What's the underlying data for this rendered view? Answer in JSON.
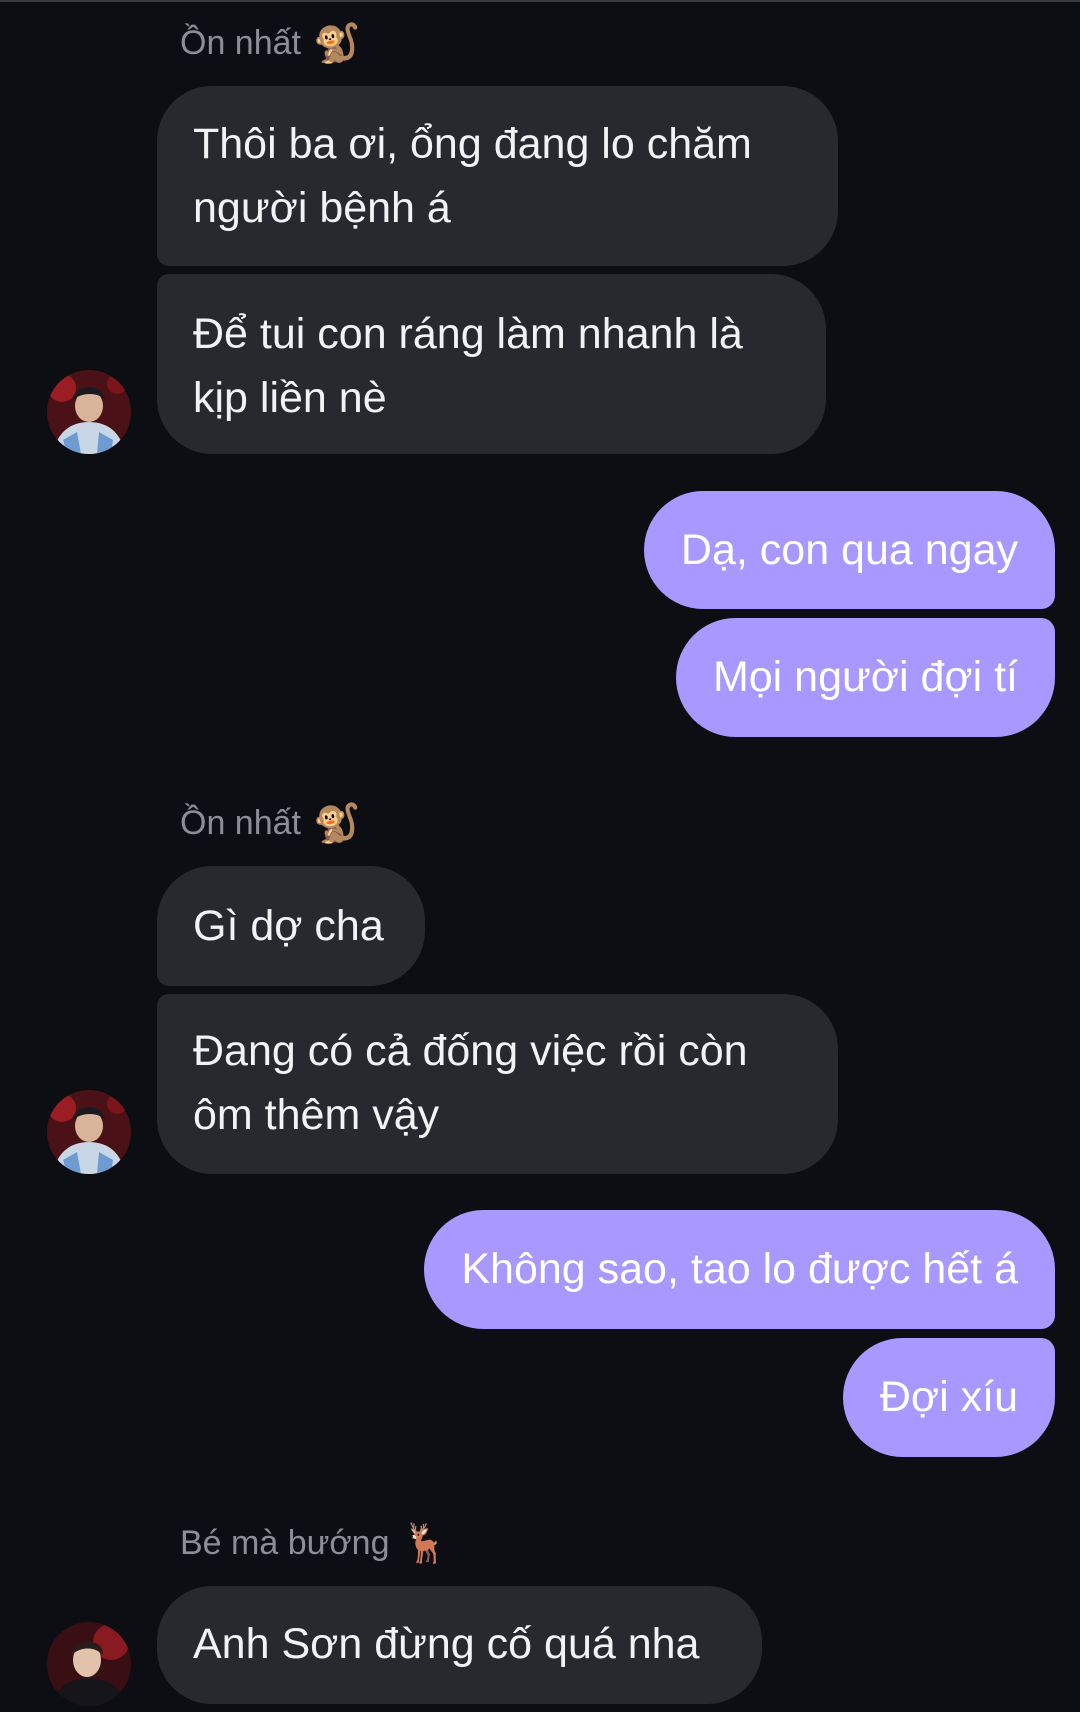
{
  "chat": {
    "groups": [
      {
        "sender": "Ồn nhất",
        "emoji": "🐒",
        "messages": [
          {
            "lines": [
              "Thôi ba ơi, ổng đang lo chăm",
              "người bệnh á"
            ]
          },
          {
            "lines": [
              "Để tui con ráng làm nhanh là",
              "kịp liền nè"
            ]
          }
        ]
      },
      {
        "outgoing": [
          {
            "text": "Dạ, con qua ngay"
          },
          {
            "text": "Mọi người đợi tí"
          }
        ]
      },
      {
        "sender": "Ồn nhất",
        "emoji": "🐒",
        "messages": [
          {
            "lines": [
              "Gì dợ cha"
            ]
          },
          {
            "lines": [
              "Đang có cả đống việc rồi còn",
              "ôm thêm vậy"
            ]
          }
        ]
      },
      {
        "outgoing": [
          {
            "text": "Không sao, tao lo được hết á"
          },
          {
            "text": "Đợi xíu"
          }
        ]
      },
      {
        "sender": "Bé mà bướng",
        "emoji": "🦌",
        "messages": [
          {
            "lines": [
              "Anh Sơn đừng cố quá nha"
            ]
          }
        ]
      }
    ]
  },
  "colors": {
    "background": "#0d0e13",
    "incoming_bubble": "#27292f",
    "outgoing_bubble": "#a898ff",
    "sender_name": "#8d8e95"
  }
}
